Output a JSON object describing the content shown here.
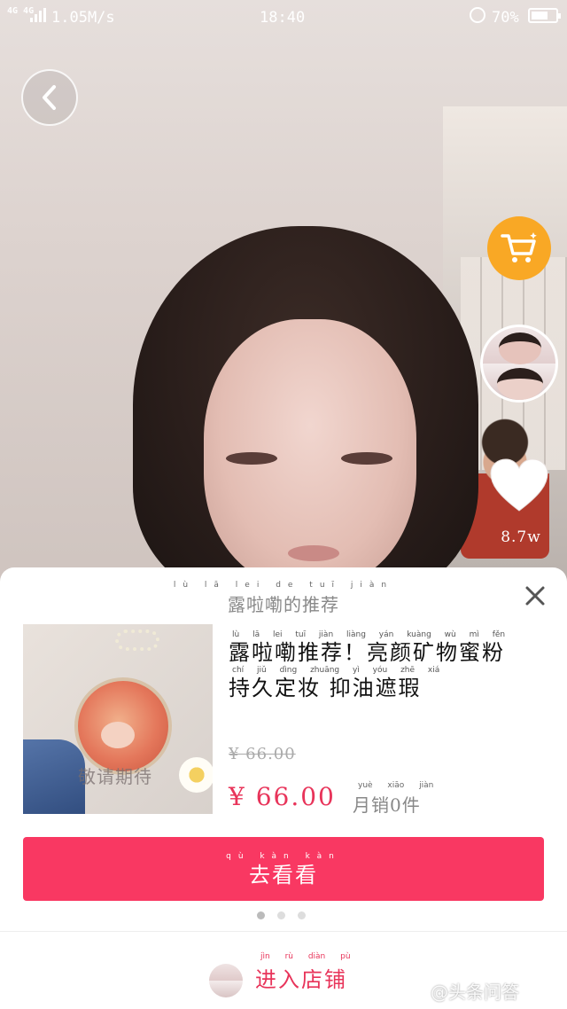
{
  "status_bar": {
    "network": "4G 4G",
    "speed": "1.05M/s",
    "time": "18:40",
    "battery": "70%",
    "battery_level": 0.7
  },
  "icons": {
    "back": "chevron-left-icon",
    "cart": "shopping-cart-icon",
    "like": "heart-icon",
    "close": "close-icon"
  },
  "side": {
    "like_count": "8.7w"
  },
  "sheet": {
    "title_pinyin": "lù lā lei de tuī jiàn",
    "title": "露啦嘞的推荐",
    "product": {
      "image_caption": "敬请期待",
      "title_pinyin_1": "lù lā lei tuī jiàn liàng yán kuàng wù mì fěn",
      "title_line_1": "露啦嘞推荐！亮颜矿物蜜粉",
      "title_pinyin_2": "chí jiǔ dìng zhuāng yì yóu zhē xiá",
      "title_line_2": "持久定妆 抑油遮瑕",
      "old_price": "¥ 66.00",
      "price": "¥ 66.00",
      "sales_pinyin": "yuè xiāo jiàn",
      "sales": "月销0件"
    },
    "cta_pinyin": "qù kàn kàn",
    "cta": "去看看",
    "pager": {
      "count": 3,
      "active": 0
    },
    "shop_pinyin": "jìn rù diàn pù",
    "shop": "进入店铺",
    "watermark": "@头条问答"
  },
  "colors": {
    "accent": "#f93862",
    "price": "#e8345a",
    "cart": "#f9a825"
  }
}
